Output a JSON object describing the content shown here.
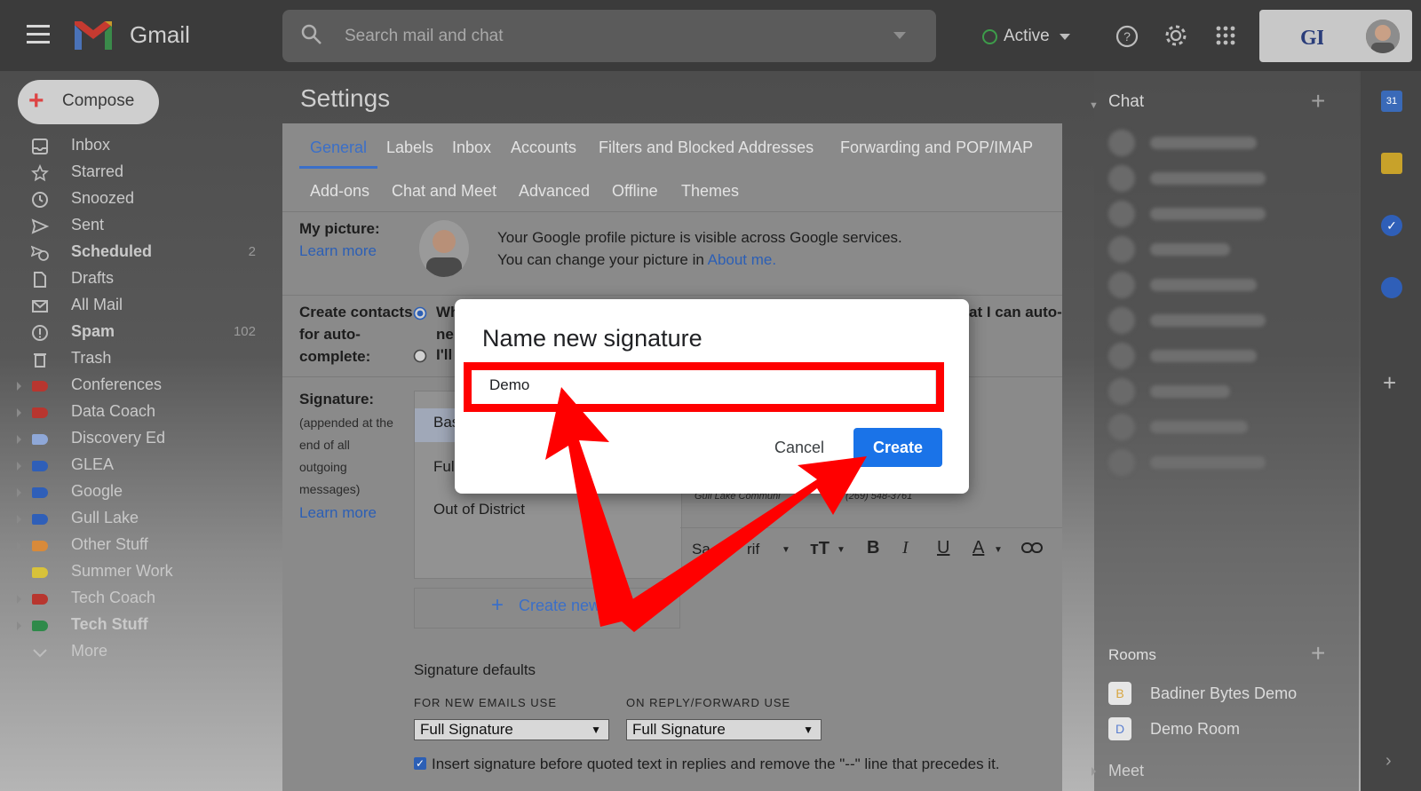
{
  "app": {
    "name": "Gmail"
  },
  "search": {
    "placeholder": "Search mail and chat"
  },
  "status": {
    "label": "Active",
    "color": "#3d9c4a"
  },
  "compose": {
    "label": "Compose"
  },
  "sidebar": {
    "items": [
      {
        "label": "Inbox",
        "icon": "inbox-icon",
        "bold": false,
        "count": ""
      },
      {
        "label": "Starred",
        "icon": "star-icon",
        "bold": false,
        "count": ""
      },
      {
        "label": "Snoozed",
        "icon": "clock-icon",
        "bold": false,
        "count": ""
      },
      {
        "label": "Sent",
        "icon": "send-icon",
        "bold": false,
        "count": ""
      },
      {
        "label": "Scheduled",
        "icon": "scheduled-icon",
        "bold": true,
        "count": "2"
      },
      {
        "label": "Drafts",
        "icon": "draft-icon",
        "bold": false,
        "count": ""
      },
      {
        "label": "All Mail",
        "icon": "mail-icon",
        "bold": false,
        "count": ""
      },
      {
        "label": "Spam",
        "icon": "spam-icon",
        "bold": true,
        "count": "102"
      },
      {
        "label": "Trash",
        "icon": "trash-icon",
        "bold": false,
        "count": ""
      },
      {
        "label": "Conferences",
        "icon": "label-icon",
        "color": "#b8362f",
        "arrow": true
      },
      {
        "label": "Data Coach",
        "icon": "label-icon",
        "color": "#b8362f",
        "arrow": true
      },
      {
        "label": "Discovery Ed",
        "icon": "label-icon",
        "color": "#8fa8d8",
        "arrow": true
      },
      {
        "label": "GLEA",
        "icon": "label-icon",
        "color": "#2f5fb8",
        "arrow": true
      },
      {
        "label": "Google",
        "icon": "label-icon",
        "color": "#2f5fb8",
        "arrow": true
      },
      {
        "label": "Gull Lake",
        "icon": "label-icon",
        "color": "#2f5fb8",
        "arrow": true
      },
      {
        "label": "Other Stuff",
        "icon": "label-icon",
        "color": "#d88a3a",
        "arrow": true
      },
      {
        "label": "Summer Work",
        "icon": "label-icon",
        "color": "#d8c23a",
        "arrow": false
      },
      {
        "label": "Tech Coach",
        "icon": "label-icon",
        "color": "#b8362f",
        "arrow": true
      },
      {
        "label": "Tech Stuff",
        "icon": "label-icon",
        "color": "#2f8a4a",
        "arrow": true,
        "bold": true
      },
      {
        "label": "More",
        "icon": "chevron-down-icon",
        "bold": false,
        "count": ""
      }
    ]
  },
  "settings": {
    "title": "Settings",
    "tabs_row1": [
      "General",
      "Labels",
      "Inbox",
      "Accounts",
      "Filters and Blocked Addresses",
      "Forwarding and POP/IMAP"
    ],
    "tabs_row2": [
      "Add-ons",
      "Chat and Meet",
      "Advanced",
      "Offline",
      "Themes"
    ],
    "my_picture": {
      "label": "My picture:",
      "learn_more": "Learn more",
      "line1": "Your Google profile picture is visible across Google services.",
      "line2_prefix": "You can change your picture in ",
      "line2_link": "About me."
    },
    "contacts": {
      "label1": "Create contacts",
      "label2": "for auto-",
      "label3": "complete:",
      "opt1_fragment": "Wh",
      "opt1_fragment2": "ne",
      "opt1_tail": "at I can auto-",
      "opt2_fragment": "I'll"
    },
    "signature": {
      "label": "Signature:",
      "desc1": "(appended at the",
      "desc2": "end of all",
      "desc3": "outgoing",
      "desc4": "messages)",
      "learn_more": "Learn more",
      "list": [
        "Bas",
        "Ful",
        "Out of District"
      ],
      "create_new": "Create new",
      "preview_text": "Gull Lake Communi",
      "preview_phone": "(269) 548-3761",
      "font_label": "Sa",
      "font_label_tail": "rif"
    },
    "defaults": {
      "title": "Signature defaults",
      "new_label": "FOR NEW EMAILS USE",
      "reply_label": "ON REPLY/FORWARD USE",
      "new_value": "Full Signature",
      "reply_value": "Full Signature",
      "insert_text": "Insert signature before quoted text in replies and remove the \"--\" line that precedes it."
    }
  },
  "chat": {
    "title": "Chat",
    "rooms_title": "Rooms",
    "rooms": [
      {
        "initial": "B",
        "name": "Badiner Bytes Demo",
        "color": "#d8a640"
      },
      {
        "initial": "D",
        "name": "Demo Room",
        "color": "#5b7fd0"
      }
    ],
    "meet_title": "Meet"
  },
  "dialog": {
    "title": "Name new signature",
    "input_value": "Demo",
    "cancel": "Cancel",
    "create": "Create",
    "accent": "#1a73e8",
    "highlight": "#ff0000"
  }
}
